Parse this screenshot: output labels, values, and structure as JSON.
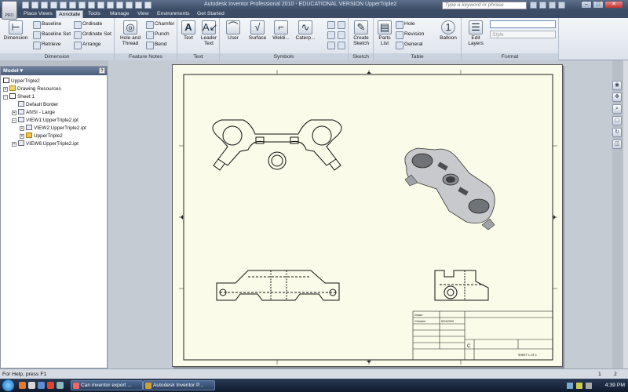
{
  "window": {
    "title": "Autodesk Inventor Professional 2010 - EDUCATIONAL VERSION     UpperTriple2",
    "search_placeholder": "Type a keyword or phrase",
    "logo_text": "PRO"
  },
  "tabs": [
    "Place Views",
    "Annotate",
    "Tools",
    "Manage",
    "View",
    "Environments",
    "Get Started"
  ],
  "active_tab": "Annotate",
  "ribbon": {
    "dimension": {
      "label": "Dimension",
      "big": "Dimension",
      "baseline": "Baseline",
      "baseline_set": "Baseline Set",
      "retrieve": "Retrieve",
      "ordinate": "Ordinate",
      "ordinate_set": "Ordinate Set",
      "arrange": "Arrange"
    },
    "feature_notes": {
      "label": "Feature Notes",
      "hole_thread": "Hole and Thread",
      "chamfer": "Chamfer",
      "punch": "Punch",
      "bend": "Bend"
    },
    "text": {
      "label": "Text",
      "text": "Text",
      "leader_text": "Leader Text"
    },
    "symbols": {
      "label": "Symbols",
      "user": "User",
      "surface": "Surface",
      "welding": "Weldi...",
      "caterpillar": "Caterp..."
    },
    "sketch": {
      "label": "Sketch",
      "create_sketch": "Create Sketch"
    },
    "table": {
      "label": "Table",
      "parts_list": "Parts List",
      "hole": "Hole",
      "revision": "Revision",
      "general": "General",
      "balloon": "Balloon"
    },
    "format": {
      "label": "Format",
      "edit_layers": "Edit Layers",
      "style_placeholder": "Style"
    }
  },
  "browser": {
    "title": "Model",
    "items": [
      {
        "label": "UpperTriple2",
        "icon": "drawing-icon"
      },
      {
        "label": "Drawing Resources",
        "icon": "folder-icon"
      },
      {
        "label": "Sheet:1",
        "icon": "sheet-icon"
      },
      {
        "label": "Default Border",
        "icon": "border-icon"
      },
      {
        "label": "ANSI - Large",
        "icon": "titleblock-icon"
      },
      {
        "label": "VIEW1:UpperTriple2.ipt",
        "icon": "view-icon"
      },
      {
        "label": "VIEW2:UpperTriple2.ipt",
        "icon": "view-icon"
      },
      {
        "label": "UpperTriple2",
        "icon": "part-icon"
      },
      {
        "label": "VIEW6:UpperTriple2.ipt",
        "icon": "view-icon"
      }
    ]
  },
  "titleblock": {
    "drawn": "Drawn",
    "checked": "Checked",
    "date": "8/24/2009",
    "size": "C",
    "sheet": "SHEET 1 OF 1"
  },
  "status": {
    "help": "For Help, press F1",
    "n1": "1",
    "n2": "2"
  },
  "taskbar": {
    "tasks": [
      "Can inventor export ...",
      "Autodesk Inventor P..."
    ],
    "clock": "4:39 PM"
  }
}
